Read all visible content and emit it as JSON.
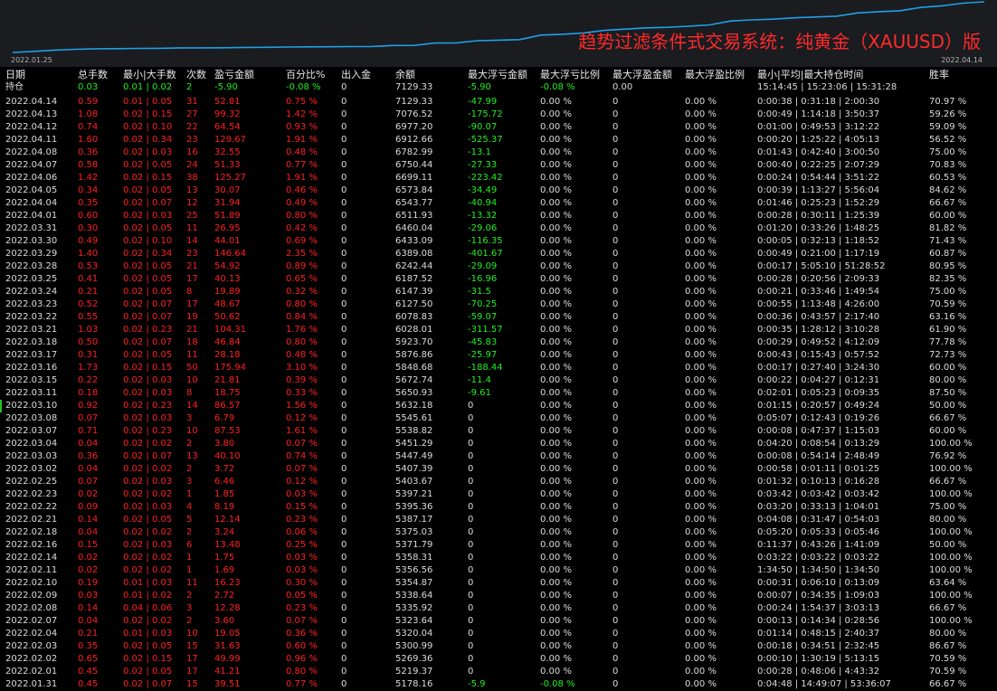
{
  "chart": {
    "title": "趋势过滤条件式交易系统：纯黄金（XAUUSD）版",
    "date_start": "2022.01.25",
    "date_end": "2022.04.14",
    "line_color": "#1ea0e6",
    "title_color": "#ff2a2a"
  },
  "headers": [
    "日期",
    "总手数",
    "最小|大手数",
    "次数",
    "盈亏金额",
    "百分比%",
    "出入金",
    "余额",
    "最大浮亏金额",
    "最大浮亏比例",
    "最大浮盈金额",
    "最大浮盈比例",
    "最小|平均|最大持仓时间",
    "胜率"
  ],
  "position": {
    "label": "持仓",
    "lots": "0.03",
    "minmax": "0.01 | 0.02",
    "count": "2",
    "pnl": "-5.90",
    "pct": "-0.08 %",
    "inout": "0",
    "balance": "7129.33",
    "max_dd": "-5.90",
    "max_dd_pct": "-0.08 %",
    "max_fp": "0.00",
    "max_fp_pct": "",
    "hold": "15:14:45 | 15:23:06 | 15:31:28",
    "winrate": ""
  },
  "rows": [
    [
      "2022.04.14",
      "0.59",
      "0.01 | 0.05",
      "31",
      "52.81",
      "0.75 %",
      "0",
      "7129.33",
      "-47.99",
      "0.00 %",
      "0",
      "0.00 %",
      "0:00:38 | 0:31:18 | 2:00:30",
      "70.97 %"
    ],
    [
      "2022.04.13",
      "1.08",
      "0.02 | 0.15",
      "27",
      "99.32",
      "1.42 %",
      "0",
      "7076.52",
      "-175.72",
      "0.00 %",
      "0",
      "0.00 %",
      "0:00:49 | 1:14:18 | 3:50:37",
      "59.26 %"
    ],
    [
      "2022.04.12",
      "0.74",
      "0.02 | 0.10",
      "22",
      "64.54",
      "0.93 %",
      "0",
      "6977.20",
      "-90.07",
      "0.00 %",
      "0",
      "0.00 %",
      "0:01:00 | 0:49:53 | 3:12:22",
      "59.09 %"
    ],
    [
      "2022.04.11",
      "1.60",
      "0.02 | 0.34",
      "23",
      "129.67",
      "1.91 %",
      "0",
      "6912.66",
      "-525.37",
      "0.00 %",
      "0",
      "0.00 %",
      "0:00:20 | 1:25:22 | 4:05:13",
      "56.52 %"
    ],
    [
      "2022.04.08",
      "0.36",
      "0.02 | 0.03",
      "16",
      "32.55",
      "0.48 %",
      "0",
      "6782.99",
      "-13.1",
      "0.00 %",
      "0",
      "0.00 %",
      "0:01:43 | 0:42:40 | 3:00:50",
      "75.00 %"
    ],
    [
      "2022.04.07",
      "0.58",
      "0.02 | 0.05",
      "24",
      "51.33",
      "0.77 %",
      "0",
      "6750.44",
      "-27.33",
      "0.00 %",
      "0",
      "0.00 %",
      "0:00:40 | 0:22:25 | 2:07:29",
      "70.83 %"
    ],
    [
      "2022.04.06",
      "1.42",
      "0.02 | 0.15",
      "38",
      "125.27",
      "1.91 %",
      "0",
      "6699.11",
      "-223.42",
      "0.00 %",
      "0",
      "0.00 %",
      "0:00:24 | 0:54:44 | 3:51:22",
      "60.53 %"
    ],
    [
      "2022.04.05",
      "0.34",
      "0.02 | 0.05",
      "13",
      "30.07",
      "0.46 %",
      "0",
      "6573.84",
      "-34.49",
      "0.00 %",
      "0",
      "0.00 %",
      "0:00:39 | 1:13:27 | 5:56:04",
      "84.62 %"
    ],
    [
      "2022.04.04",
      "0.35",
      "0.02 | 0.07",
      "12",
      "31.94",
      "0.49 %",
      "0",
      "6543.77",
      "-40.94",
      "0.00 %",
      "0",
      "0.00 %",
      "0:01:46 | 0:25:23 | 1:52:29",
      "66.67 %"
    ],
    [
      "2022.04.01",
      "0.60",
      "0.02 | 0.03",
      "25",
      "51.89",
      "0.80 %",
      "0",
      "6511.93",
      "-13.32",
      "0.00 %",
      "0",
      "0.00 %",
      "0:00:28 | 0:30:11 | 1:25:39",
      "60.00 %"
    ],
    [
      "2022.03.31",
      "0.30",
      "0.02 | 0.05",
      "11",
      "26.95",
      "0.42 %",
      "0",
      "6460.04",
      "-29.06",
      "0.00 %",
      "0",
      "0.00 %",
      "0:01:20 | 0:33:26 | 1:48:25",
      "81.82 %"
    ],
    [
      "2022.03.30",
      "0.49",
      "0.02 | 0.10",
      "14",
      "44.01",
      "0.69 %",
      "0",
      "6433.09",
      "-116.35",
      "0.00 %",
      "0",
      "0.00 %",
      "0:00:05 | 0:32:13 | 1:18:52",
      "71.43 %"
    ],
    [
      "2022.03.29",
      "1.40",
      "0.02 | 0.34",
      "23",
      "146.64",
      "2.35 %",
      "0",
      "6389.08",
      "-401.67",
      "0.00 %",
      "0",
      "0.00 %",
      "0:00:49 | 0:21:00 | 1:17:19",
      "60.87 %"
    ],
    [
      "2022.03.28",
      "0.53",
      "0.02 | 0.05",
      "21",
      "54.92",
      "0.89 %",
      "0",
      "6242.44",
      "-29.09",
      "0.00 %",
      "0",
      "0.00 %",
      "0:00:17 | 5:05:10 | 51:28:52",
      "80.95 %"
    ],
    [
      "2022.03.25",
      "0.41",
      "0.02 | 0.05",
      "17",
      "40.13",
      "0.65 %",
      "0",
      "6187.52",
      "-16.96",
      "0.00 %",
      "0",
      "0.00 %",
      "0:00:28 | 0:20:56 | 2:09:33",
      "82.35 %"
    ],
    [
      "2022.03.24",
      "0.21",
      "0.02 | 0.05",
      "8",
      "19.89",
      "0.32 %",
      "0",
      "6147.39",
      "-31.5",
      "0.00 %",
      "0",
      "0.00 %",
      "0:00:21 | 0:33:46 | 1:49:54",
      "75.00 %"
    ],
    [
      "2022.03.23",
      "0.52",
      "0.02 | 0.07",
      "17",
      "48.67",
      "0.80 %",
      "0",
      "6127.50",
      "-70.25",
      "0.00 %",
      "0",
      "0.00 %",
      "0:00:55 | 1:13:48 | 4:26:00",
      "70.59 %"
    ],
    [
      "2022.03.22",
      "0.55",
      "0.02 | 0.07",
      "19",
      "50.62",
      "0.84 %",
      "0",
      "6078.83",
      "-59.07",
      "0.00 %",
      "0",
      "0.00 %",
      "0:00:36 | 0:43:57 | 2:17:40",
      "63.16 %"
    ],
    [
      "2022.03.21",
      "1.03",
      "0.02 | 0.23",
      "21",
      "104.31",
      "1.76 %",
      "0",
      "6028.01",
      "-311.57",
      "0.00 %",
      "0",
      "0.00 %",
      "0:00:35 | 1:28:12 | 3:10:28",
      "61.90 %"
    ],
    [
      "2022.03.18",
      "0.50",
      "0.02 | 0.07",
      "18",
      "46.84",
      "0.80 %",
      "0",
      "5923.70",
      "-45.83",
      "0.00 %",
      "0",
      "0.00 %",
      "0:00:29 | 0:49:52 | 4:12:09",
      "77.78 %"
    ],
    [
      "2022.03.17",
      "0.31",
      "0.02 | 0.05",
      "11",
      "28.18",
      "0.48 %",
      "0",
      "5876.86",
      "-25.97",
      "0.00 %",
      "0",
      "0.00 %",
      "0:00:43 | 0:15:43 | 0:57:52",
      "72.73 %"
    ],
    [
      "2022.03.16",
      "1.73",
      "0.02 | 0.15",
      "50",
      "175.94",
      "3.10 %",
      "0",
      "5848.68",
      "-188.44",
      "0.00 %",
      "0",
      "0.00 %",
      "0:00:17 | 0:27:40 | 3:24:30",
      "60.00 %"
    ],
    [
      "2022.03.15",
      "0.22",
      "0.02 | 0.03",
      "10",
      "21.81",
      "0.39 %",
      "0",
      "5672.74",
      "-11.4",
      "0.00 %",
      "0",
      "0.00 %",
      "0:00:22 | 0:04:27 | 0:12:31",
      "80.00 %"
    ],
    [
      "2022.03.11",
      "0.18",
      "0.02 | 0.03",
      "8",
      "18.75",
      "0.33 %",
      "0",
      "5650.93",
      "-9.61",
      "0.00 %",
      "0",
      "0.00 %",
      "0:02:01 | 0:05:23 | 0:09:35",
      "87.50 %"
    ],
    [
      "2022.03.10",
      "0.92",
      "0.02 | 0.23",
      "14",
      "86.57",
      "1.56 %",
      "0",
      "5632.18",
      "0",
      "0.00 %",
      "0",
      "0.00 %",
      "0:01:15 | 0:20:57 | 0:49:24",
      "50.00 %"
    ],
    [
      "2022.03.08",
      "0.07",
      "0.02 | 0.03",
      "3",
      "6.79",
      "0.12 %",
      "0",
      "5545.61",
      "0",
      "0.00 %",
      "0",
      "0.00 %",
      "0:05:07 | 0:12:43 | 0:19:26",
      "66.67 %"
    ],
    [
      "2022.03.07",
      "0.71",
      "0.02 | 0.23",
      "10",
      "87.53",
      "1.61 %",
      "0",
      "5538.82",
      "0",
      "0.00 %",
      "0",
      "0.00 %",
      "0:00:08 | 0:47:37 | 1:15:03",
      "60.00 %"
    ],
    [
      "2022.03.04",
      "0.04",
      "0.02 | 0.02",
      "2",
      "3.80",
      "0.07 %",
      "0",
      "5451.29",
      "0",
      "0.00 %",
      "0",
      "0.00 %",
      "0:04:20 | 0:08:54 | 0:13:29",
      "100.00 %"
    ],
    [
      "2022.03.03",
      "0.36",
      "0.02 | 0.07",
      "13",
      "40.10",
      "0.74 %",
      "0",
      "5447.49",
      "0",
      "0.00 %",
      "0",
      "0.00 %",
      "0:00:08 | 0:54:14 | 2:48:49",
      "76.92 %"
    ],
    [
      "2022.03.02",
      "0.04",
      "0.02 | 0.02",
      "2",
      "3.72",
      "0.07 %",
      "0",
      "5407.39",
      "0",
      "0.00 %",
      "0",
      "0.00 %",
      "0:00:58 | 0:01:11 | 0:01:25",
      "100.00 %"
    ],
    [
      "2022.02.25",
      "0.07",
      "0.02 | 0.03",
      "3",
      "6.46",
      "0.12 %",
      "0",
      "5403.67",
      "0",
      "0.00 %",
      "0",
      "0.00 %",
      "0:01:32 | 0:10:13 | 0:16:28",
      "66.67 %"
    ],
    [
      "2022.02.23",
      "0.02",
      "0.02 | 0.02",
      "1",
      "1.85",
      "0.03 %",
      "0",
      "5397.21",
      "0",
      "0.00 %",
      "0",
      "0.00 %",
      "0:03:42 | 0:03:42 | 0:03:42",
      "100.00 %"
    ],
    [
      "2022.02.22",
      "0.09",
      "0.02 | 0.03",
      "4",
      "8.19",
      "0.15 %",
      "0",
      "5395.36",
      "0",
      "0.00 %",
      "0",
      "0.00 %",
      "0:03:20 | 0:33:13 | 1:04:01",
      "75.00 %"
    ],
    [
      "2022.02.21",
      "0.14",
      "0.02 | 0.05",
      "5",
      "12.14",
      "0.23 %",
      "0",
      "5387.17",
      "0",
      "0.00 %",
      "0",
      "0.00 %",
      "0:04:08 | 0:31:47 | 0:54:03",
      "80.00 %"
    ],
    [
      "2022.02.18",
      "0.04",
      "0.02 | 0.02",
      "2",
      "3.24",
      "0.06 %",
      "0",
      "5375.03",
      "0",
      "0.00 %",
      "0",
      "0.00 %",
      "0:05:20 | 0:05:33 | 0:05:46",
      "100.00 %"
    ],
    [
      "2022.02.16",
      "0.15",
      "0.02 | 0.03",
      "6",
      "13.48",
      "0.25 %",
      "0",
      "5371.79",
      "0",
      "0.00 %",
      "0",
      "0.00 %",
      "0:11:37 | 0:43:26 | 1:41:09",
      "50.00 %"
    ],
    [
      "2022.02.14",
      "0.02",
      "0.02 | 0.02",
      "1",
      "1.75",
      "0.03 %",
      "0",
      "5358.31",
      "0",
      "0.00 %",
      "0",
      "0.00 %",
      "0:03:22 | 0:03:22 | 0:03:22",
      "100.00 %"
    ],
    [
      "2022.02.11",
      "0.02",
      "0.02 | 0.02",
      "1",
      "1.69",
      "0.03 %",
      "0",
      "5356.56",
      "0",
      "0.00 %",
      "0",
      "0.00 %",
      "1:34:50 | 1:34:50 | 1:34:50",
      "100.00 %"
    ],
    [
      "2022.02.10",
      "0.19",
      "0.01 | 0.03",
      "11",
      "16.23",
      "0.30 %",
      "0",
      "5354.87",
      "0",
      "0.00 %",
      "0",
      "0.00 %",
      "0:00:31 | 0:06:10 | 0:13:09",
      "63.64 %"
    ],
    [
      "2022.02.09",
      "0.03",
      "0.01 | 0.02",
      "2",
      "2.72",
      "0.05 %",
      "0",
      "5338.64",
      "0",
      "0.00 %",
      "0",
      "0.00 %",
      "0:00:07 | 0:34:35 | 1:09:03",
      "100.00 %"
    ],
    [
      "2022.02.08",
      "0.14",
      "0.04 | 0.06",
      "3",
      "12.28",
      "0.23 %",
      "0",
      "5335.92",
      "0",
      "0.00 %",
      "0",
      "0.00 %",
      "0:00:24 | 1:54:37 | 3:03:13",
      "66.67 %"
    ],
    [
      "2022.02.07",
      "0.04",
      "0.02 | 0.02",
      "2",
      "3.60",
      "0.07 %",
      "0",
      "5323.64",
      "0",
      "0.00 %",
      "0",
      "0.00 %",
      "0:00:13 | 0:14:34 | 0:28:56",
      "100.00 %"
    ],
    [
      "2022.02.04",
      "0.21",
      "0.01 | 0.03",
      "10",
      "19.05",
      "0.36 %",
      "0",
      "5320.04",
      "0",
      "0.00 %",
      "0",
      "0.00 %",
      "0:01:14 | 0:48:15 | 2:40:37",
      "80.00 %"
    ],
    [
      "2022.02.03",
      "0.35",
      "0.02 | 0.05",
      "15",
      "31.63",
      "0.60 %",
      "0",
      "5300.99",
      "0",
      "0.00 %",
      "0",
      "0.00 %",
      "0:00:18 | 0:34:51 | 2:32:45",
      "86.67 %"
    ],
    [
      "2022.02.02",
      "0.65",
      "0.02 | 0.15",
      "17",
      "49.99",
      "0.96 %",
      "0",
      "5269.36",
      "0",
      "0.00 %",
      "0",
      "0.00 %",
      "0:00:10 | 1:30:19 | 5:13:15",
      "70.59 %"
    ],
    [
      "2022.02.01",
      "0.45",
      "0.02 | 0.05",
      "17",
      "41.21",
      "0.80 %",
      "0",
      "5219.37",
      "0",
      "0.00 %",
      "0",
      "0.00 %",
      "0:00:28 | 0:48:06 | 4:43:32",
      "70.59 %"
    ],
    [
      "2022.01.31",
      "0.45",
      "0.02 | 0.07",
      "15",
      "39.51",
      "0.77 %",
      "0",
      "5178.16",
      "-5.9",
      "-0.08 %",
      "0",
      "0.00 %",
      "0:04:48 | 14:49:07 | 53:36:07",
      "66.67 %"
    ]
  ]
}
